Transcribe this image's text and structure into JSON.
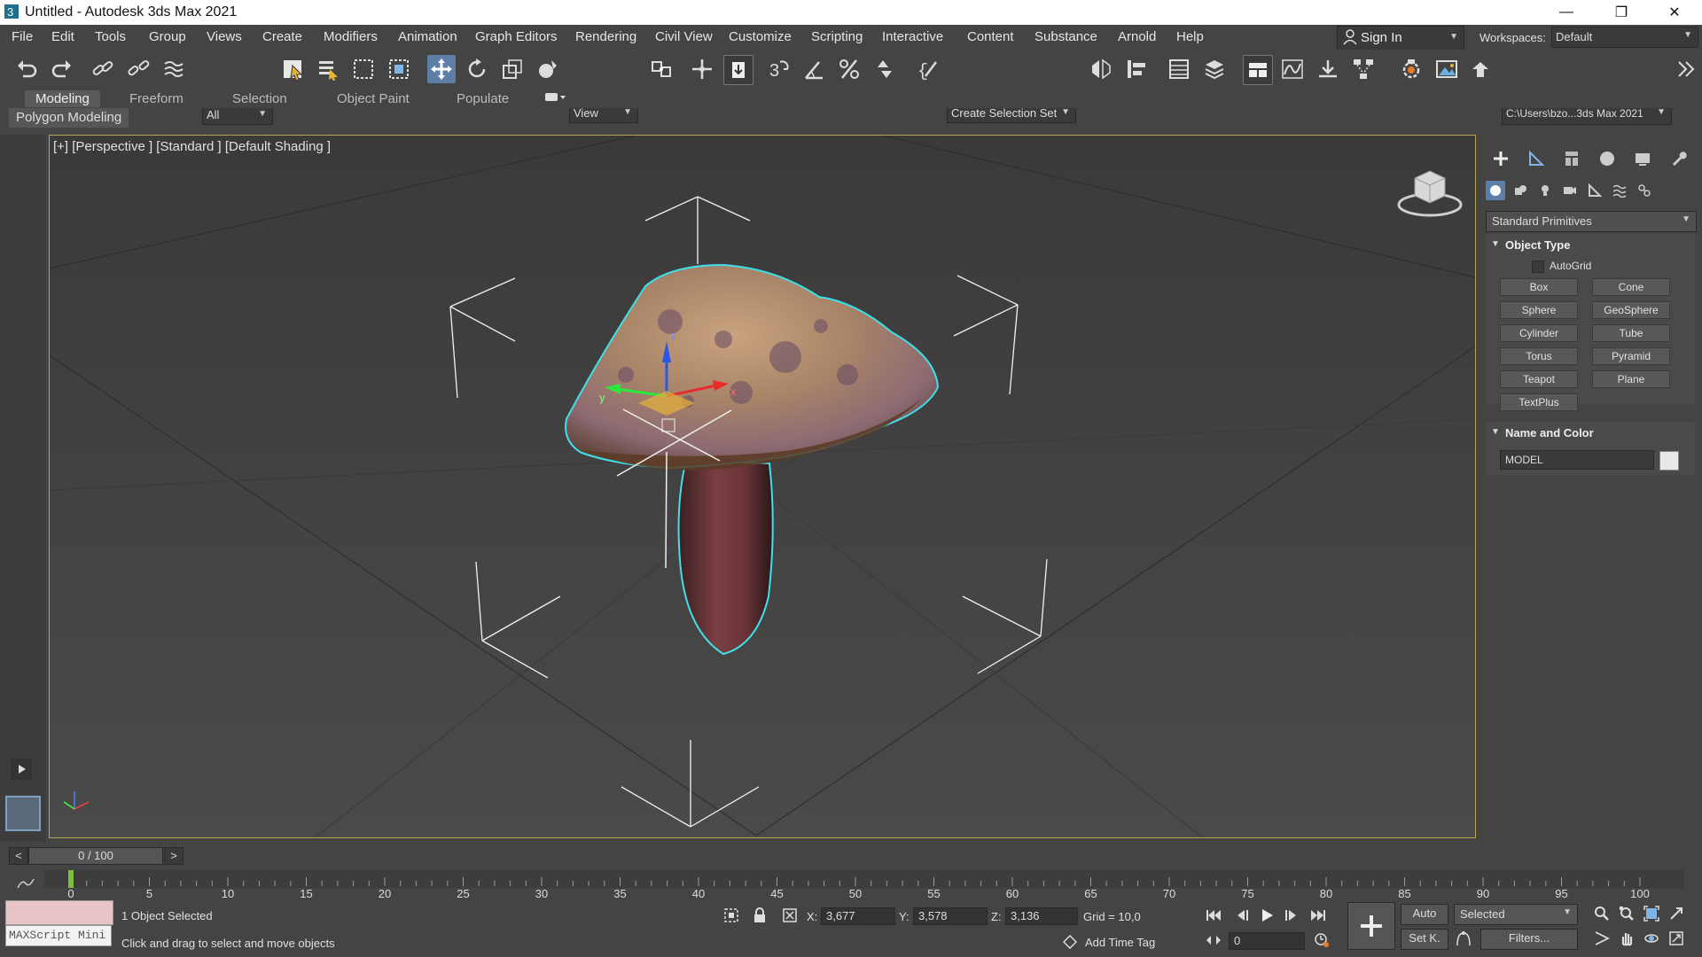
{
  "window": {
    "title": "Untitled - Autodesk 3ds Max 2021"
  },
  "menu": [
    "File",
    "Edit",
    "Tools",
    "Group",
    "Views",
    "Create",
    "Modifiers",
    "Animation",
    "Graph Editors",
    "Rendering",
    "Civil View",
    "Customize",
    "Scripting",
    "Interactive",
    "Content",
    "Substance",
    "Arnold",
    "Help"
  ],
  "account": {
    "sign_in": "Sign In",
    "workspaces_label": "Workspaces:",
    "workspace_value": "Default"
  },
  "toolbar": {
    "filter_value": "All",
    "ref_coord_value": "View",
    "selection_set_value": "Create Selection Set",
    "path_value": "C:\\Users\\bzo...3ds Max 2021"
  },
  "ribbon": {
    "tabs": [
      "Modeling",
      "Freeform",
      "Selection",
      "Object Paint",
      "Populate"
    ],
    "active_tab": "Modeling",
    "sub_label": "Polygon Modeling"
  },
  "viewport": {
    "label": "[+] [Perspective ] [Standard ] [Default Shading ]",
    "axis_x": "x",
    "axis_y": "y",
    "axis_z": "z"
  },
  "command_panel": {
    "category_value": "Standard Primitives",
    "object_type_title": "Object Type",
    "autogrid_label": "AutoGrid",
    "buttons": [
      "Box",
      "Cone",
      "Sphere",
      "GeoSphere",
      "Cylinder",
      "Tube",
      "Torus",
      "Pyramid",
      "Teapot",
      "Plane",
      "TextPlus"
    ],
    "name_color_title": "Name and Color",
    "object_name": "MODEL",
    "object_color": "#e8e8e8"
  },
  "timeline": {
    "slider_text": "0 / 100",
    "prev": "<",
    "next": ">",
    "ticks": [
      "0",
      "5",
      "10",
      "15",
      "20",
      "25",
      "30",
      "35",
      "40",
      "45",
      "50",
      "55",
      "60",
      "65",
      "70",
      "75",
      "80",
      "85",
      "90",
      "95",
      "100"
    ]
  },
  "status": {
    "selection_text": "1 Object Selected",
    "prompt_text": "Click and drag to select and move objects",
    "maxscript_label": "MAXScript Mini",
    "x_label": "X:",
    "x_value": "3,677",
    "y_label": "Y:",
    "y_value": "3,578",
    "z_label": "Z:",
    "z_value": "3,136",
    "grid_text": "Grid = 10,0",
    "add_time_tag": "Add Time Tag",
    "auto_label": "Auto",
    "selected_value": "Selected",
    "set_key_label": "Set K.",
    "filters_label": "Filters...",
    "frame_value": "0"
  },
  "colors": {
    "accent": "#5d7ea6",
    "selection_outline": "#3fe0e8",
    "viewport_border": "#b8a350"
  }
}
